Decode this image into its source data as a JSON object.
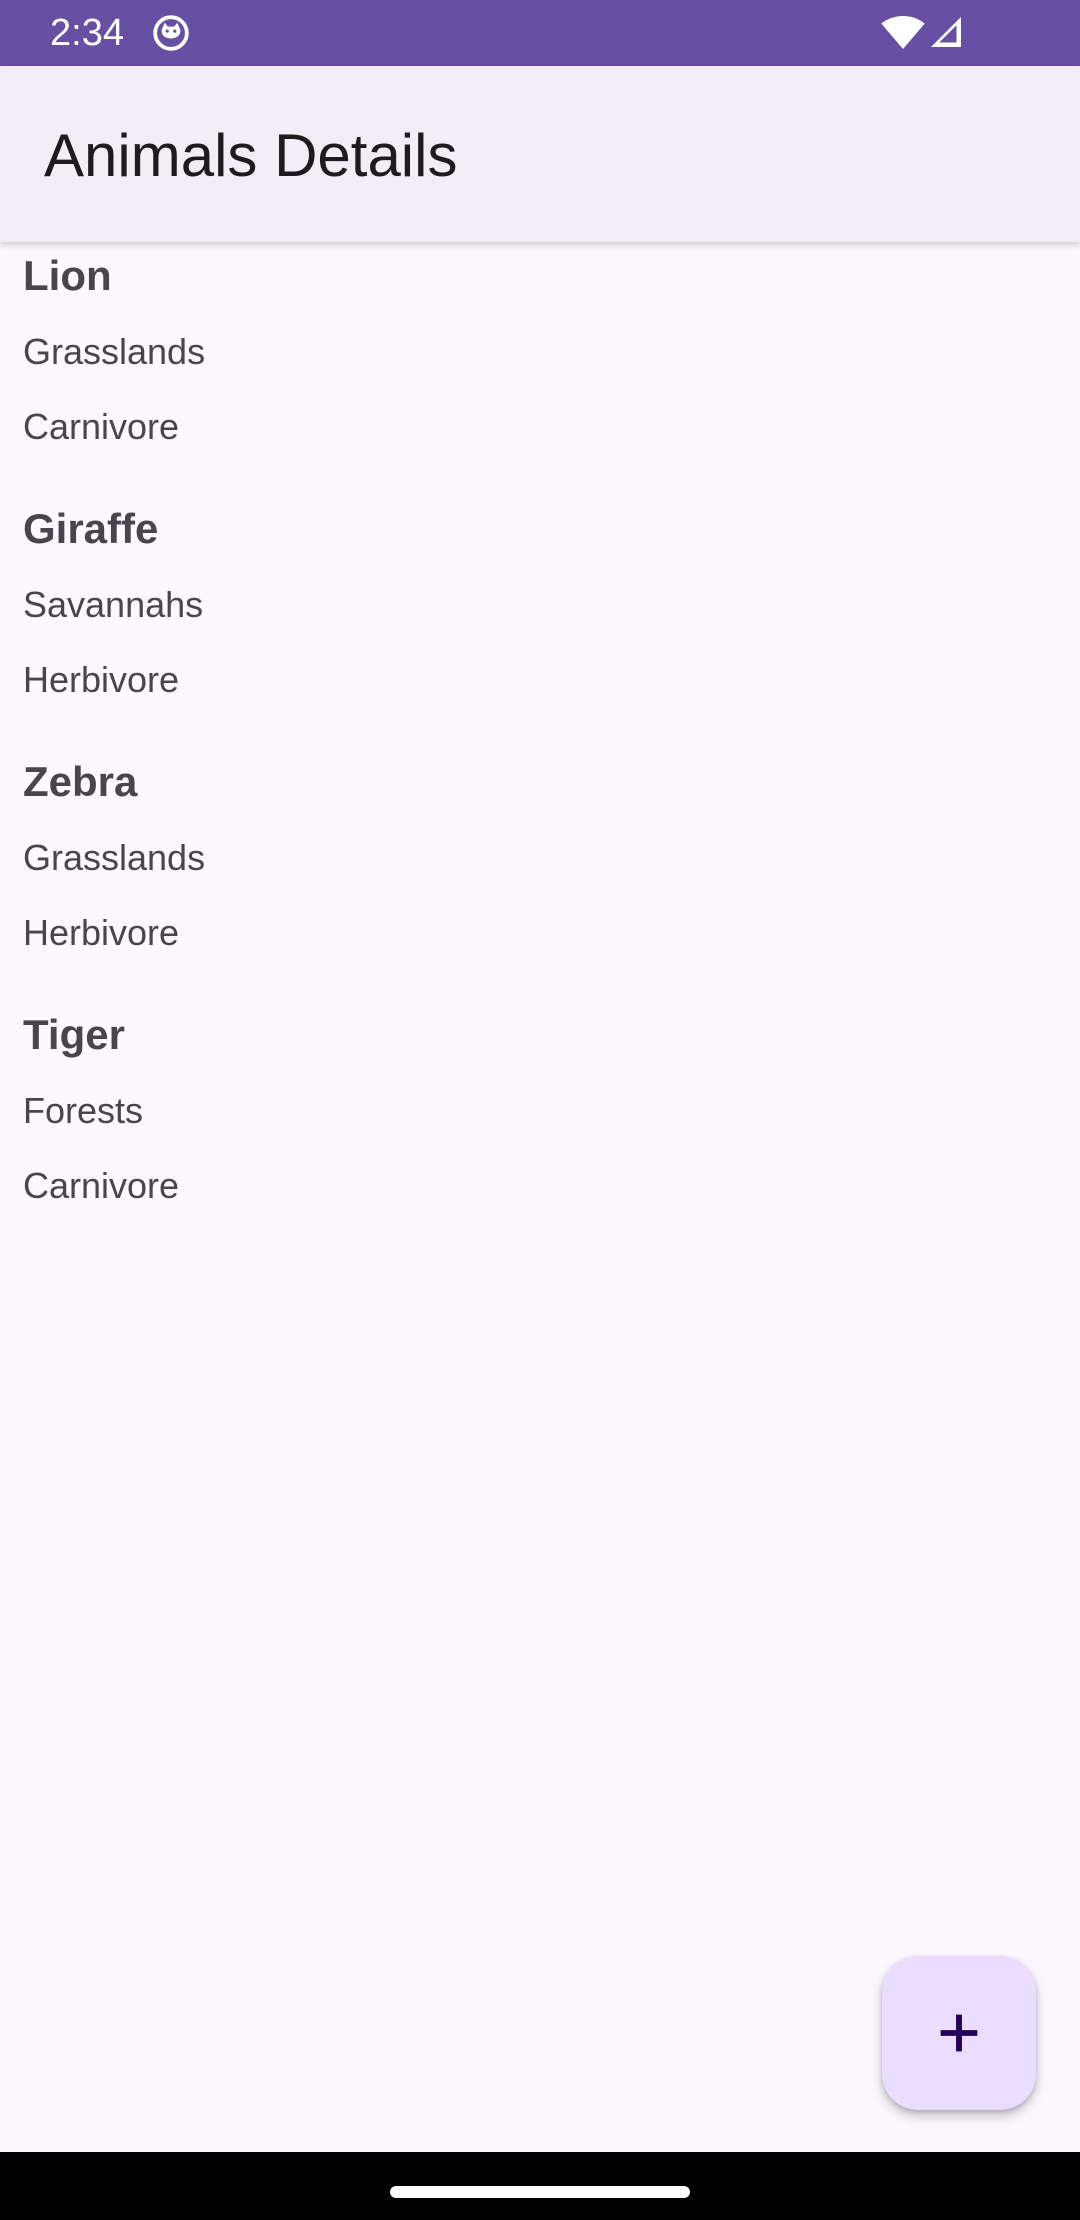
{
  "status_bar": {
    "time": "2:34",
    "icons": [
      "cat-notification-icon",
      "wifi-icon",
      "cell-signal-icon"
    ],
    "color": "#6750a4"
  },
  "app_bar": {
    "title": "Animals Details",
    "background": "#f3edf7"
  },
  "animals": [
    {
      "name": "Lion",
      "habitat": "Grasslands",
      "diet": "Carnivore"
    },
    {
      "name": "Giraffe",
      "habitat": "Savannahs",
      "diet": "Herbivore"
    },
    {
      "name": "Zebra",
      "habitat": "Grasslands",
      "diet": "Herbivore"
    },
    {
      "name": "Tiger",
      "habitat": "Forests",
      "diet": "Carnivore"
    }
  ],
  "fab": {
    "icon": "plus-icon",
    "background": "#eaddff",
    "icon_color": "#21005d"
  },
  "theme": {
    "page_background": "#fdf7ff",
    "text_color": "#49454f"
  }
}
